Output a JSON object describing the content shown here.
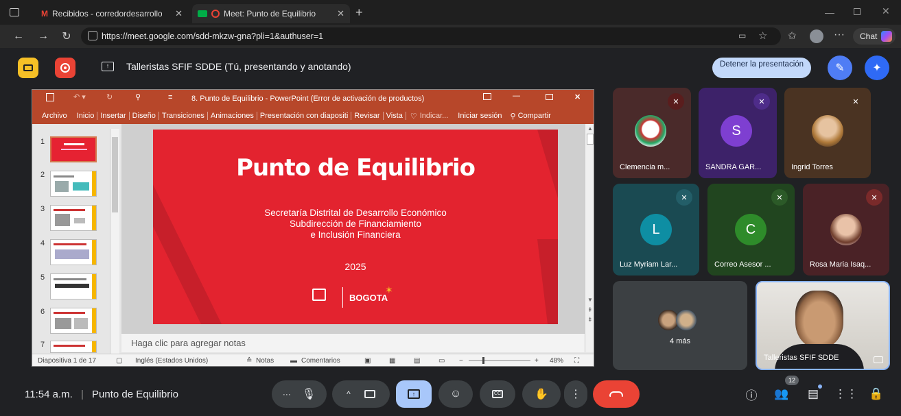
{
  "browser": {
    "tabs": [
      {
        "label": "Recibidos - corredordesarrolloeco",
        "close": "✕"
      },
      {
        "label": "Meet: Punto de Equilibrio",
        "close": "✕"
      }
    ],
    "new_tab": "+",
    "url": "https://meet.google.com/sdd-mkzw-gna?pli=1&authuser=1",
    "chat_label": "Chat"
  },
  "meet": {
    "presenting_text": "Talleristas SFIF SDDE (Tú, presentando y anotando)",
    "stop_presenting_label": "Detener la presentación",
    "clock": "11:54 a.m.",
    "meeting_title": "Punto de Equilibrio",
    "participant_count": "12",
    "participants": [
      {
        "name": "Clemencia m...",
        "initial": ""
      },
      {
        "name": "SANDRA GAR...",
        "initial": "S"
      },
      {
        "name": "Ingrid Torres",
        "initial": ""
      },
      {
        "name": "Luz Myriam Lar...",
        "initial": "L"
      },
      {
        "name": "Correo Asesor ...",
        "initial": "C"
      },
      {
        "name": "Rosa Maria Isaq...",
        "initial": ""
      }
    ],
    "more_label": "4 más",
    "self_name": "Talleristas SFIF SDDE"
  },
  "ppt": {
    "window_title": "8. Punto de Equilibrio - PowerPoint (Error de activación de productos)",
    "menu": [
      "Archivo",
      "Inicio",
      "Insertar",
      "Diseño",
      "Transiciones",
      "Animaciones",
      "Presentación con diapositi",
      "Revisar",
      "Vista"
    ],
    "tell_me": "Indicar...",
    "sign_in": "Iniciar sesión",
    "share": "Compartir",
    "thumb_numbers": [
      "1",
      "2",
      "3",
      "4",
      "5",
      "6",
      "7"
    ],
    "slide": {
      "title": "Punto de Equilibrio",
      "line1": "Secretaría Distrital de Desarrollo Económico",
      "line2": "Subdirección de Financiamiento",
      "line3": "e Inclusión Financiera",
      "year": "2025",
      "logo_text": "BOGOTA"
    },
    "notes_placeholder": "Haga clic para agregar notas",
    "status": {
      "slide_of": "Diapositiva 1 de 17",
      "language": "Inglés (Estados Unidos)",
      "notes": "Notas",
      "comments": "Comentarios",
      "zoom": "48%"
    }
  },
  "colors": {
    "ppt_red": "#b7472a",
    "slide_red": "#e3232f",
    "hangup_red": "#ea4335",
    "stop_blue": "#c2d8fa",
    "present_blue": "#a8c7fa"
  }
}
